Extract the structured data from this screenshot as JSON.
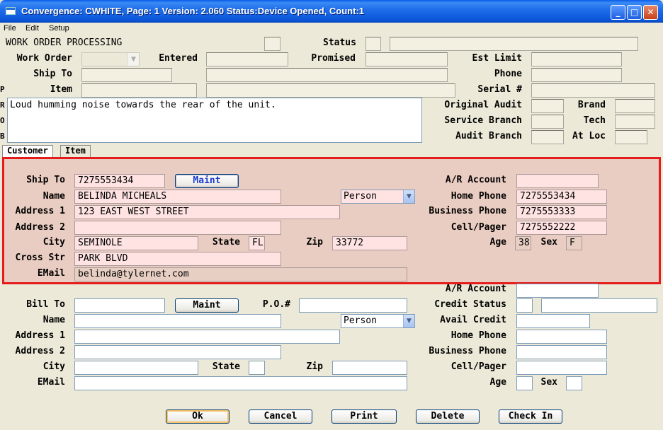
{
  "window": {
    "title": "Convergence: CWHITE, Page: 1 Version: 2.060 Status:Device Opened, Count:1"
  },
  "menu": [
    "File",
    "Edit",
    "Setup"
  ],
  "header": {
    "section_title": "WORK ORDER PROCESSING",
    "status_label": "Status",
    "work_order_label": "Work Order",
    "entered_label": "Entered",
    "promised_label": "Promised",
    "est_limit_label": "Est Limit",
    "ship_to_label": "Ship To",
    "phone_label": "Phone",
    "item_label": "Item",
    "serial_label": "Serial #",
    "original_audit_label": "Original Audit",
    "brand_label": "Brand",
    "service_branch_label": "Service Branch",
    "tech_label": "Tech",
    "audit_branch_label": "Audit Branch",
    "at_loc_label": "At Loc",
    "problem_text": "Loud humming noise towards the rear of the unit.",
    "edge_letters": [
      "P",
      "R",
      "O",
      "B"
    ]
  },
  "tabs": [
    "Customer",
    "Item"
  ],
  "ship_to": {
    "ship_to_label": "Ship To",
    "ship_to_value": "7275553434",
    "maint_label": "Maint",
    "name_label": "Name",
    "name_value": "BELINDA MICHEALS",
    "type_value": "Person",
    "address1_label": "Address 1",
    "address1_value": "123 EAST WEST STREET",
    "address2_label": "Address 2",
    "address2_value": "",
    "city_label": "City",
    "city_value": "SEMINOLE",
    "state_label": "State",
    "state_value": "FL",
    "zip_label": "Zip",
    "zip_value": "33772",
    "cross_str_label": "Cross Str",
    "cross_str_value": "PARK BLVD",
    "email_label": "EMail",
    "email_value": "belinda@tylernet.com",
    "ar_account_label": "A/R Account",
    "ar_account_value": "",
    "home_phone_label": "Home Phone",
    "home_phone_value": "7275553434",
    "business_phone_label": "Business Phone",
    "business_phone_value": "7275553333",
    "cell_label": "Cell/Pager",
    "cell_value": "7275552222",
    "age_label": "Age",
    "age_value": "38",
    "sex_label": "Sex",
    "sex_value": "F"
  },
  "bill_to": {
    "ar_account_label": "A/R Account",
    "bill_to_label": "Bill To",
    "maint_label": "Maint",
    "po_label": "P.O.#",
    "credit_status_label": "Credit Status",
    "name_label": "Name",
    "type_value": "Person",
    "avail_credit_label": "Avail Credit",
    "address1_label": "Address 1",
    "home_phone_label": "Home Phone",
    "address2_label": "Address 2",
    "business_phone_label": "Business Phone",
    "city_label": "City",
    "state_label": "State",
    "zip_label": "Zip",
    "cell_label": "Cell/Pager",
    "email_label": "EMail",
    "age_label": "Age",
    "sex_label": "Sex"
  },
  "buttons": {
    "ok": "Ok",
    "cancel": "Cancel",
    "print": "Print",
    "delete": "Delete",
    "check_in": "Check In"
  },
  "colors": {
    "highlight_border": "#E41C1C",
    "panel_bg": "#EACDC2",
    "field_pink": "#FFE3E3",
    "window_bg": "#ECE9D8"
  }
}
